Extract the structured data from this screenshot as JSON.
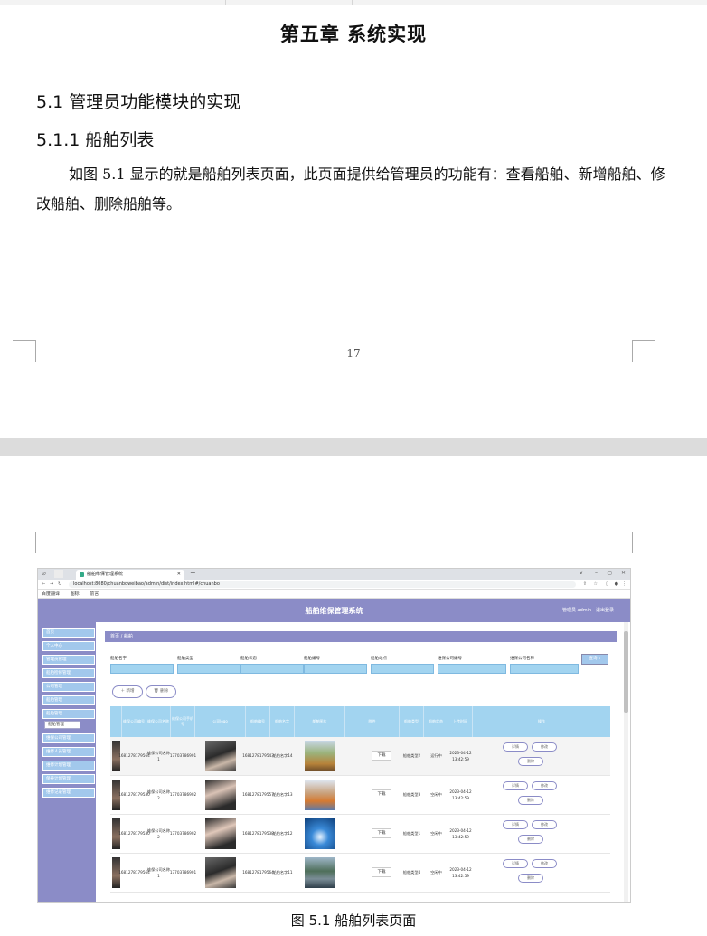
{
  "doc": {
    "chapter_title": "第五章  系统实现",
    "section_heading": "5.1  管理员功能模块的实现",
    "subsection_heading": "5.1.1  船舶列表",
    "paragraph": "如图 5.1 显示的就是船舶列表页面，此页面提供给管理员的功能有：查看船舶、新增船舶、修改船舶、删除船舶等。",
    "page_number": "17",
    "figure_caption": "图 5.1  船舶列表页面"
  },
  "browser": {
    "tab_title": "船舶维保管理系统",
    "new_tab": "+",
    "url": "localhost:8080/chuanboweibao/admin/dist/index.html#/chuanbo",
    "window_controls": [
      "∨",
      "–",
      "▢",
      "✕"
    ],
    "bookmarks": [
      "百度翻译",
      "图标",
      "前言"
    ]
  },
  "app": {
    "title": "船舶维保管理系统",
    "user": "管理员 admin",
    "logout": "退出登录",
    "sidebar": [
      "首页",
      "个人中心",
      "管理员管理",
      "船舶检修管理",
      "公司管理",
      "船舶管理",
      "船舶管理",
      "维保公司管理",
      "维修人员管理",
      "维修计划管理",
      "保养计划管理",
      "维修记录管理"
    ],
    "sidebar_sub": "船舶管理",
    "breadcrumb": "首页  /  船舶",
    "filters": [
      "船舶名字",
      "船舶类型",
      "船舶状态",
      "船舶编号",
      "船舶站点",
      "维保公司编号",
      "维保公司名称"
    ],
    "search_btn": "查询",
    "add_btn": "新增",
    "delete_btn": "删除",
    "columns": [
      "",
      "维保公司编号",
      "维保公司名称",
      "维保公司手机号",
      "公司logo",
      "船舶编号",
      "船舶名字",
      "船舶图片",
      "附件",
      "船舶类型",
      "船舶状态",
      "上传时间",
      "操作"
    ],
    "rows": [
      {
        "company_no": "1681278179564",
        "company_name": "维保公司名称1",
        "phone": "17703786901",
        "ship_no": "1681278179543",
        "ship_name": "船舶名字14",
        "attach": "下载",
        "type": "船舶类型2",
        "status": "运行中",
        "time": "2023-04-12 13:42:59"
      },
      {
        "company_no": "1681278179530",
        "company_name": "维保公司名称2",
        "phone": "17703786902",
        "ship_no": "1681278179557",
        "ship_name": "船舶名字13",
        "attach": "下载",
        "type": "船舶类型3",
        "status": "空闲中",
        "time": "2023-04-12 13:42:59"
      },
      {
        "company_no": "1681278179530",
        "company_name": "维保公司名称2",
        "phone": "17703786902",
        "ship_no": "1681278179538",
        "ship_name": "船舶名字12",
        "attach": "下载",
        "type": "船舶类型1",
        "status": "空闲中",
        "time": "2023-04-12 13:42:59"
      },
      {
        "company_no": "1681278179564",
        "company_name": "维保公司名称1",
        "phone": "17703786901",
        "ship_no": "1681278179564",
        "ship_name": "船舶名字11",
        "attach": "下载",
        "type": "船舶类型4",
        "status": "空闲中",
        "time": "2023-04-12 13:42:59"
      }
    ],
    "ops": [
      "详情",
      "修改",
      "删除"
    ]
  }
}
